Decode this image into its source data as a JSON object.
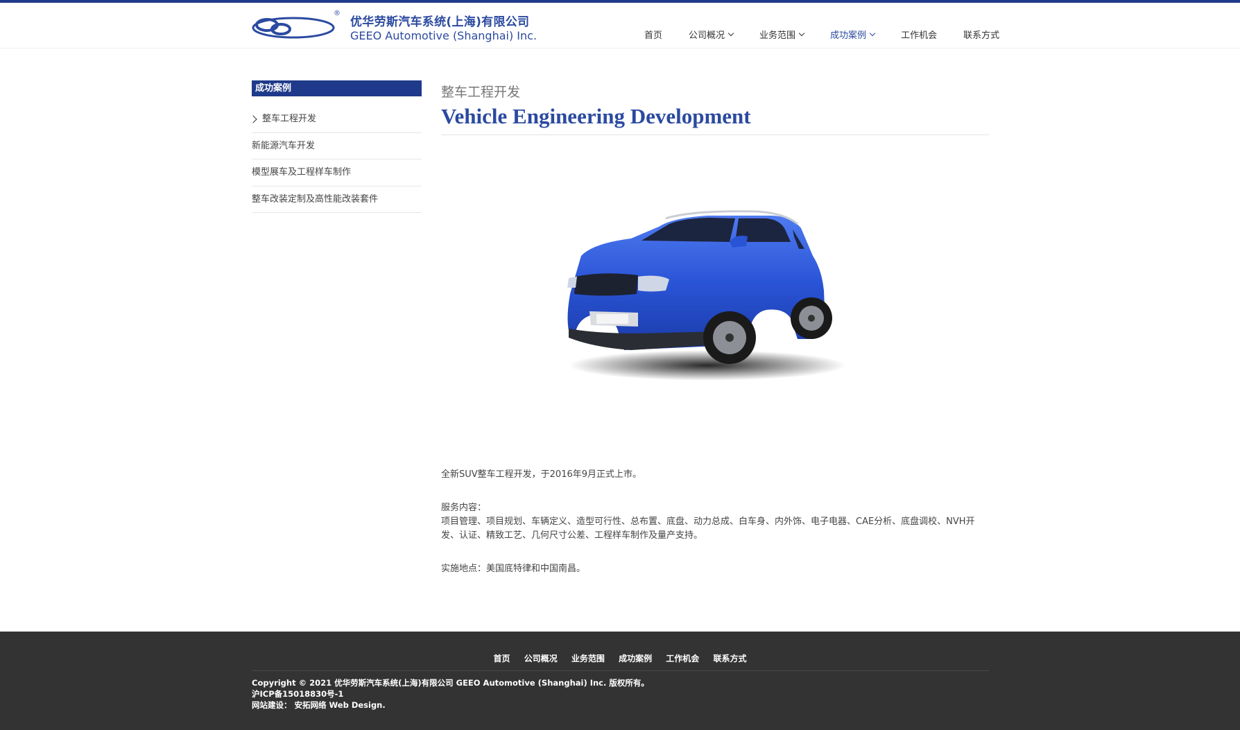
{
  "brand": {
    "name_cn": "优华劳斯汽车系统(上海)有限公司",
    "name_en": "GEEO Automotive (Shanghai) Inc.",
    "registered_mark": "®",
    "color": "#2b4aa0"
  },
  "nav": {
    "items": [
      {
        "label": "首页",
        "dropdown": false,
        "active": false
      },
      {
        "label": "公司概况",
        "dropdown": true,
        "active": false
      },
      {
        "label": "业务范围",
        "dropdown": true,
        "active": false
      },
      {
        "label": "成功案例",
        "dropdown": true,
        "active": true
      },
      {
        "label": "工作机会",
        "dropdown": false,
        "active": false
      },
      {
        "label": "联系方式",
        "dropdown": false,
        "active": false
      }
    ]
  },
  "sidebar": {
    "title": "成功案例",
    "items": [
      {
        "label": "整车工程开发",
        "active": true
      },
      {
        "label": "新能源汽车开发",
        "active": false
      },
      {
        "label": "模型展车及工程样车制作",
        "active": false
      },
      {
        "label": "整车改装定制及高性能改装套件",
        "active": false
      }
    ]
  },
  "main": {
    "subtitle": "整车工程开发",
    "title": "Vehicle Engineering Development",
    "image_alt": "blue-suv",
    "paragraphs": [
      "全新SUV整车工程开发，于2016年9月正式上市。",
      "服务内容：",
      "项目管理、项目规划、车辆定义、造型可行性、总布置、底盘、动力总成、白车身、内外饰、电子电器、CAE分析、底盘调校、NVH开发、认证、精致工艺、几何尺寸公差、工程样车制作及量产支持。",
      "实施地点：美国底特律和中国南昌。"
    ]
  },
  "footer": {
    "nav": [
      "首页",
      "公司概况",
      "业务范围",
      "成功案例",
      "工作机会",
      "联系方式"
    ],
    "copyright": "Copyright © 2021 优华劳斯汽车系统(上海)有限公司 GEEO Automotive (Shanghai) Inc. 版权所有。",
    "icp": "沪ICP备15018830号-1",
    "credit": "网站建设：  安拓网络 Web Design."
  },
  "colors": {
    "primary": "#1f3a8a",
    "footer_bg": "#333333",
    "car_blue": "#2a54d6"
  }
}
